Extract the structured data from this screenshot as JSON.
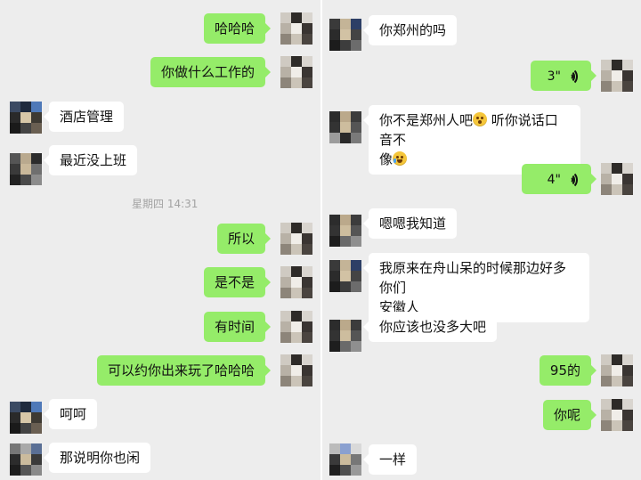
{
  "left": {
    "messages": [
      {
        "dir": "out",
        "text": "哈哈哈"
      },
      {
        "dir": "out",
        "text": "你做什么工作的"
      },
      {
        "dir": "in",
        "text": "酒店管理"
      },
      {
        "dir": "in",
        "text": "最近没上班"
      },
      {
        "dir": "out",
        "text": "所以"
      },
      {
        "dir": "out",
        "text": "是不是"
      },
      {
        "dir": "out",
        "text": "有时间"
      },
      {
        "dir": "out",
        "text": "可以约你出来玩了哈哈哈"
      },
      {
        "dir": "in",
        "text": "呵呵"
      },
      {
        "dir": "in",
        "text": "那说明你也闲"
      }
    ],
    "timestamp": "星期四 14:31"
  },
  "right": {
    "messages": [
      {
        "dir": "in",
        "text": "你郑州的吗"
      },
      {
        "dir": "out",
        "type": "voice",
        "duration": "3\""
      },
      {
        "dir": "in",
        "text_part1": "你不是郑州人吧",
        "text_part2": "听你说话口音不",
        "text_part3": "像",
        "emoji1": "flushed-face-emoji",
        "emoji2": "crying-laughing-emoji"
      },
      {
        "dir": "out",
        "type": "voice",
        "duration": "4\""
      },
      {
        "dir": "in",
        "text": "嗯嗯我知道"
      },
      {
        "dir": "in",
        "text_line1": "我原来在舟山呆的时候那边好多你们",
        "text_line2": "安徽人"
      },
      {
        "dir": "in",
        "text": "你应该也没多大吧"
      },
      {
        "dir": "out",
        "text": "95的"
      },
      {
        "dir": "out",
        "text": "你呢"
      },
      {
        "dir": "in",
        "text": "一样"
      }
    ]
  },
  "colors": {
    "background": "#ededed",
    "outgoing_bubble": "#95ec69",
    "incoming_bubble": "#ffffff",
    "timestamp": "#a3a3a3"
  }
}
